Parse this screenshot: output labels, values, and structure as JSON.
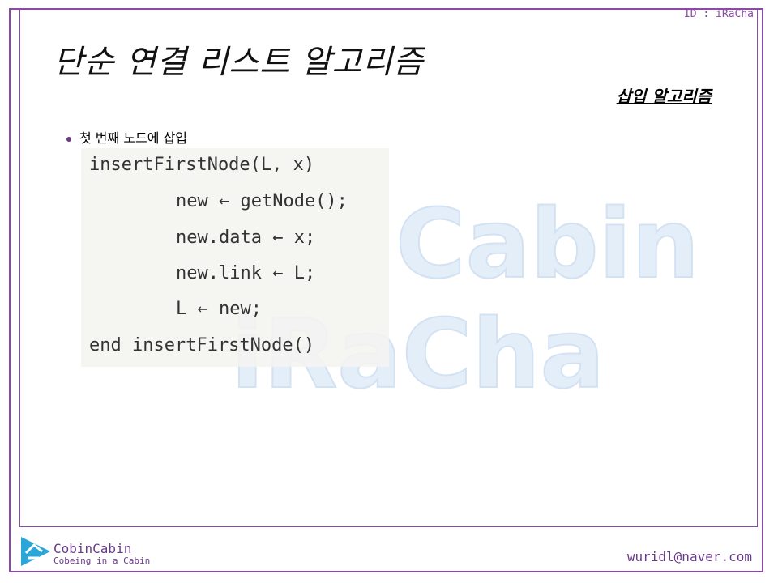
{
  "header": {
    "id_label": "ID : iRaCha",
    "title": "단순 연결 리스트 알고리즘",
    "subtitle": "삽입 알고리즘"
  },
  "content": {
    "bullet": "첫 번째 노드에 삽입",
    "code": [
      "insertFirstNode(L, x)",
      "new ← getNode();",
      "new.data ← x;",
      "new.link ← L;",
      "L ← new;",
      "end insertFirstNode()"
    ]
  },
  "watermark": {
    "line1": "Cabin",
    "line2": "iRaCha"
  },
  "footer": {
    "brand_name": "CobinCabin",
    "brand_tagline": "Cobeing in a Cabin",
    "email": "wuridl@naver.com"
  },
  "colors": {
    "accent": "#8a4aa8",
    "logo_blue": "#2aa6d8",
    "watermark": "#d3e2f2"
  },
  "icons": {
    "logo": "cobincabin-logo-icon",
    "bullet": "bullet-dot-icon"
  }
}
